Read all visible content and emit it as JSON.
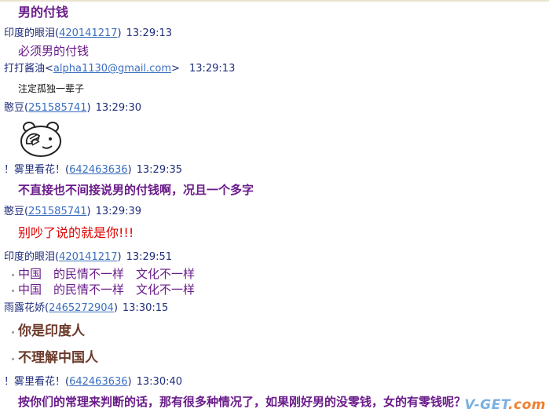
{
  "messages": [
    {
      "text": "男的付钱"
    },
    {
      "sender": "印度的眼泪",
      "qq": "420141217",
      "time": "13:29:13",
      "text": "必须男的付钱"
    },
    {
      "sender": "打打酱油",
      "email": "alpha1130@gmail.com",
      "time": "13:29:13",
      "text": "注定孤独一辈子"
    },
    {
      "sender": "憨豆",
      "qq": "251585741",
      "time": "13:29:30",
      "sticker": "bear-facepalm-icon"
    },
    {
      "sender": "！雾里看花！",
      "qq": "642463636",
      "time": "13:29:35",
      "text": "不直接也不间接说男的付钱啊，况且一个多字"
    },
    {
      "sender": "憨豆",
      "qq": "251585741",
      "time": "13:29:39",
      "text": "别吵了说的就是你!!!"
    },
    {
      "sender": "印度的眼泪",
      "qq": "420141217",
      "time": "13:29:51",
      "lines": [
        "中国　的民情不一样　文化不一样",
        "中国　的民情不一样　文化不一样"
      ]
    },
    {
      "sender": "雨露花娇",
      "qq": "2465272904",
      "time": "13:30:15",
      "lines": [
        "你是印度人",
        "不理解中国人"
      ]
    },
    {
      "sender": "！雾里看花！",
      "qq": "642463636",
      "time": "13:30:40",
      "text": "按你们的常理来判断的话，那有很多种情况了，如果刚好男的没零钱，女的有零钱呢？"
    }
  ],
  "watermark": {
    "text": "V-GET",
    "domain": ".com"
  }
}
